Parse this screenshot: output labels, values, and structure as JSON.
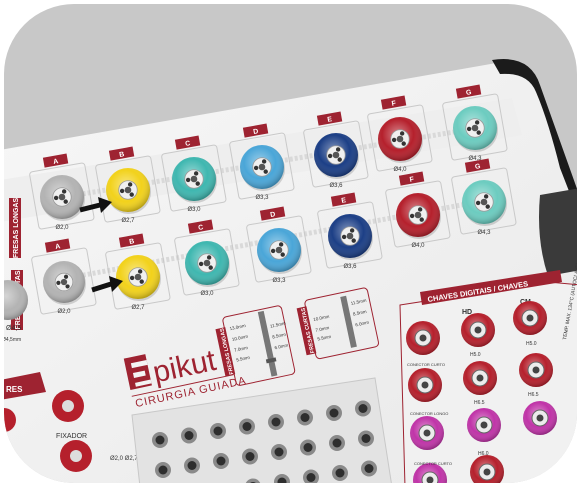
{
  "photo": {
    "subject": "surgical guided-implant kit tray",
    "colors": {
      "frame": "#c9c9c9",
      "tray": "#f4f4f4",
      "label": "#9e2331",
      "yellow": "#f2d21b",
      "teal": "#3fb7b0",
      "sky": "#4aa6d8",
      "navy": "#1c3f86",
      "red": "#b5202c",
      "mint": "#6cccc0",
      "gray": "#b3b3b3",
      "magenta": "#c034a8",
      "black": "#222222"
    }
  },
  "side_labels": {
    "long_drills": "FRESAS LONGAS",
    "short_drills": "FRESAS CURTAS"
  },
  "row1": [
    {
      "letter": "A",
      "size": "Ø2,0",
      "color": "gray"
    },
    {
      "letter": "B",
      "size": "Ø2,7",
      "color": "yellow"
    },
    {
      "letter": "C",
      "size": "Ø3,0",
      "color": "teal"
    },
    {
      "letter": "D",
      "size": "Ø3,3",
      "color": "sky"
    },
    {
      "letter": "E",
      "size": "Ø3,6",
      "color": "navy"
    },
    {
      "letter": "F",
      "size": "Ø4,0",
      "color": "red"
    },
    {
      "letter": "G",
      "size": "Ø4,3",
      "color": "mint"
    }
  ],
  "row2": [
    {
      "letter": "A",
      "size": "Ø2,0",
      "color": "gray"
    },
    {
      "letter": "B",
      "size": "Ø2,7",
      "color": "yellow"
    },
    {
      "letter": "C",
      "size": "Ø3,0",
      "color": "teal"
    },
    {
      "letter": "D",
      "size": "Ø3,3",
      "color": "sky"
    },
    {
      "letter": "E",
      "size": "Ø3,6",
      "color": "navy"
    },
    {
      "letter": "F",
      "size": "Ø4,0",
      "color": "red"
    },
    {
      "letter": "G",
      "size": "Ø4,3",
      "color": "mint"
    }
  ],
  "left_partial": {
    "size_top": "Ø4,5",
    "size_bottom": "Ø4,5mm",
    "header_fragment": "RES",
    "fixer_label": "FIXADOR",
    "pin_sizes": "Ø2,0\nØ2,7"
  },
  "brand": {
    "name": "pikut",
    "subtitle": "CIRURGIA GUIADA"
  },
  "gauge_long": {
    "title": "FRESAS LONGAS",
    "left_marks": [
      "13.0mm",
      "10.0mm",
      "7.0mm",
      "5.5mm"
    ],
    "right_marks": [
      "11.5mm",
      "8.5mm",
      "6.0mm"
    ]
  },
  "gauge_short": {
    "title": "FRESAS CURTAS",
    "left_marks": [
      "10.0mm",
      "7.0mm",
      "5.5mm"
    ],
    "right_marks": [
      "11.5mm",
      "8.5mm",
      "6.0mm"
    ]
  },
  "keys_panel": {
    "header": "CHAVES DIGITAIS / CHAVES",
    "col_hd": "HD",
    "col_cm": "CM",
    "labels": [
      "CONECTOR CURTO",
      "CONECTOR LONGO",
      "CONECTOR CURTO"
    ],
    "sizes": [
      "H5.0",
      "H5.0",
      "H6.5",
      "H6.5",
      "H6.0"
    ],
    "temp_note": "TEMP. MAX.\n134°C (AUTOCLAVE)"
  }
}
